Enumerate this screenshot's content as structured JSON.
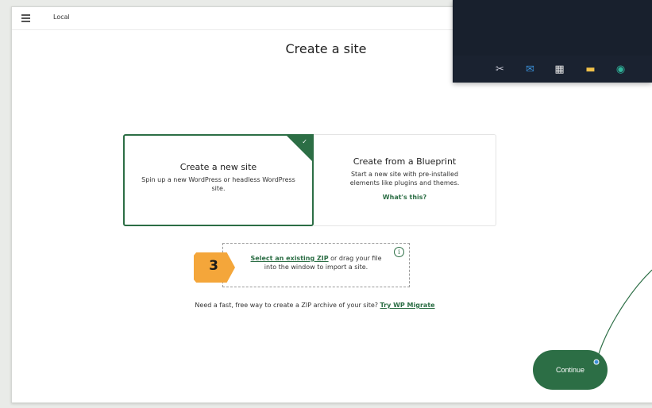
{
  "app": {
    "title": "Local"
  },
  "page": {
    "title": "Create a site"
  },
  "cards": {
    "new_site": {
      "title": "Create a new site",
      "description": "Spin up a new WordPress or headless WordPress site."
    },
    "blueprint": {
      "title": "Create from a Blueprint",
      "description": "Start a new site with pre-installed elements like plugins and themes.",
      "link": "What's this?"
    }
  },
  "import": {
    "link": "Select an existing ZIP",
    "text": " or drag your file into the window to import a site."
  },
  "migrate": {
    "text": "Need a fast, free way to create a ZIP archive of your site? ",
    "link": "Try WP Migrate"
  },
  "continue_button": {
    "label": "Continue"
  },
  "annotation": {
    "step_number": "3"
  },
  "colors": {
    "accent": "#2c6e45",
    "badge": "#f4a63a"
  },
  "taskbar": {
    "icons": [
      "snipping-tool-icon",
      "mail-icon",
      "store-icon",
      "file-explorer-icon",
      "edge-icon"
    ]
  }
}
